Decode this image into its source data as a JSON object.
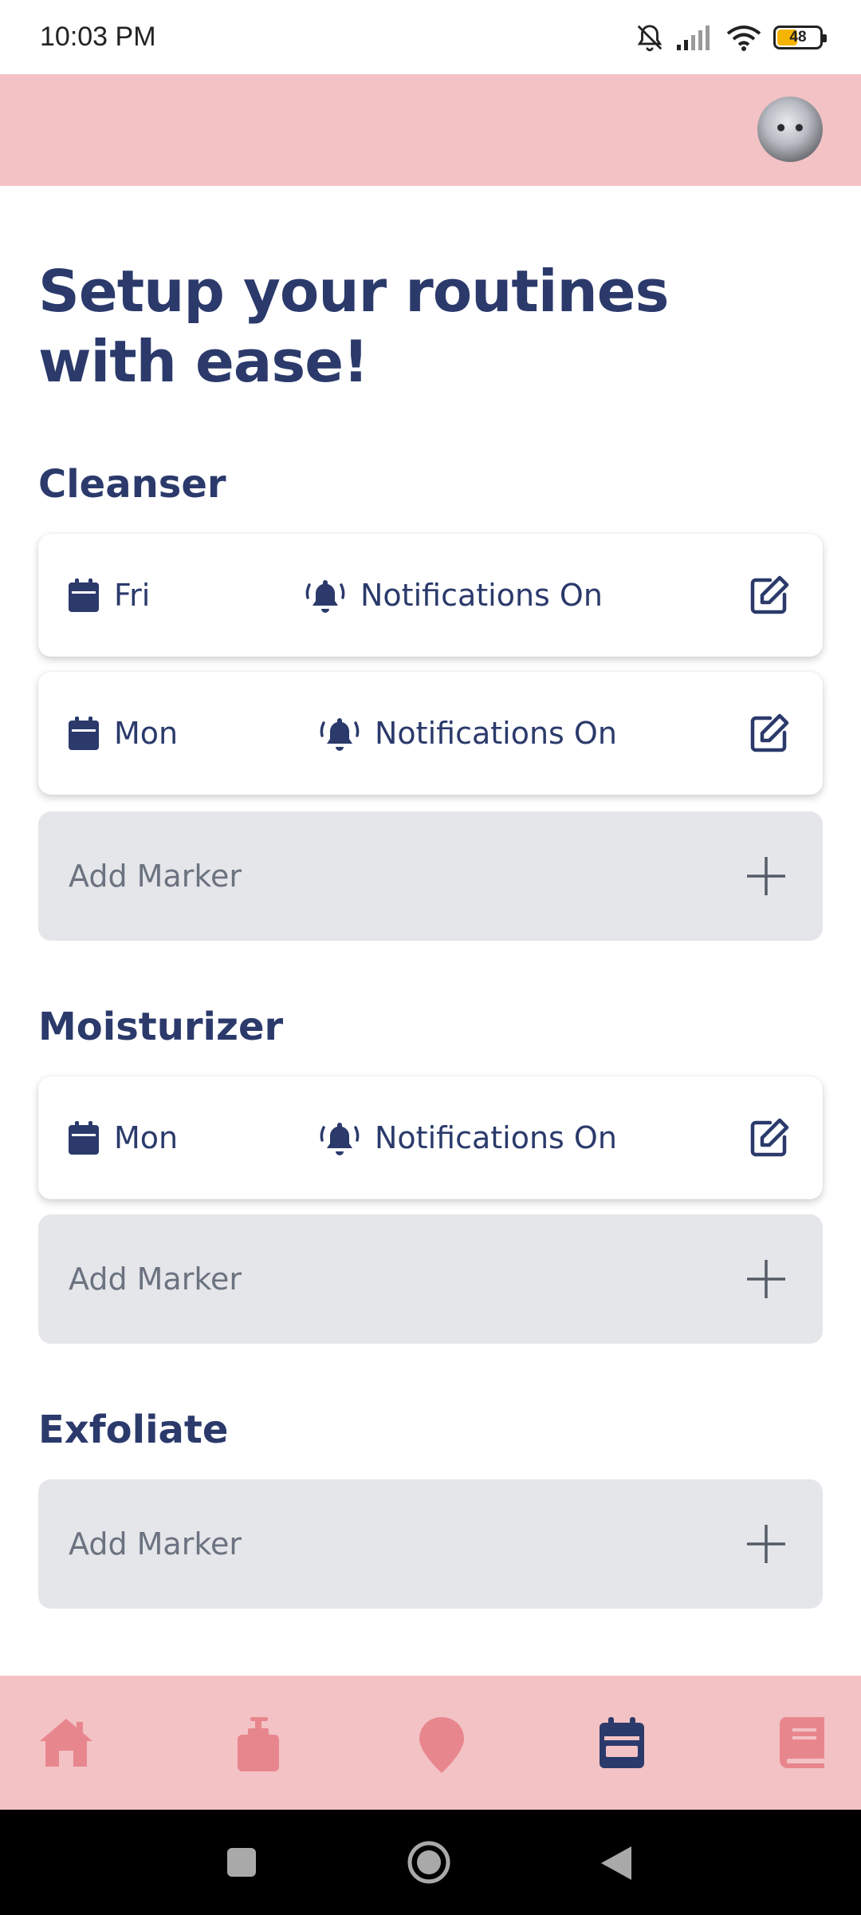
{
  "status_bar": {
    "time": "10:03 PM",
    "battery": "48"
  },
  "header": {
    "avatar": "user-avatar"
  },
  "page_title": "Setup your routines with ease!",
  "sections": [
    {
      "title": "Cleanser",
      "markers": [
        {
          "day": "Fri",
          "notification": "Notifications On"
        },
        {
          "day": "Mon",
          "notification": "Notifications On"
        }
      ],
      "add_label": "Add Marker"
    },
    {
      "title": "Moisturizer",
      "markers": [
        {
          "day": "Mon",
          "notification": "Notifications On"
        }
      ],
      "add_label": "Add Marker"
    },
    {
      "title": "Exfoliate",
      "markers": [],
      "add_label": "Add Marker"
    }
  ],
  "bottom_nav": {
    "items": [
      "home-icon",
      "product-bottle-icon",
      "location-pin-icon",
      "calendar-icon",
      "book-icon"
    ],
    "active": "calendar-icon",
    "active_color": "#2b3a6b",
    "inactive_color": "#e8868d"
  },
  "colors": {
    "header_bg": "#f3c2c5",
    "primary": "#2b3a6b",
    "add_bg": "#e5e6ea"
  }
}
